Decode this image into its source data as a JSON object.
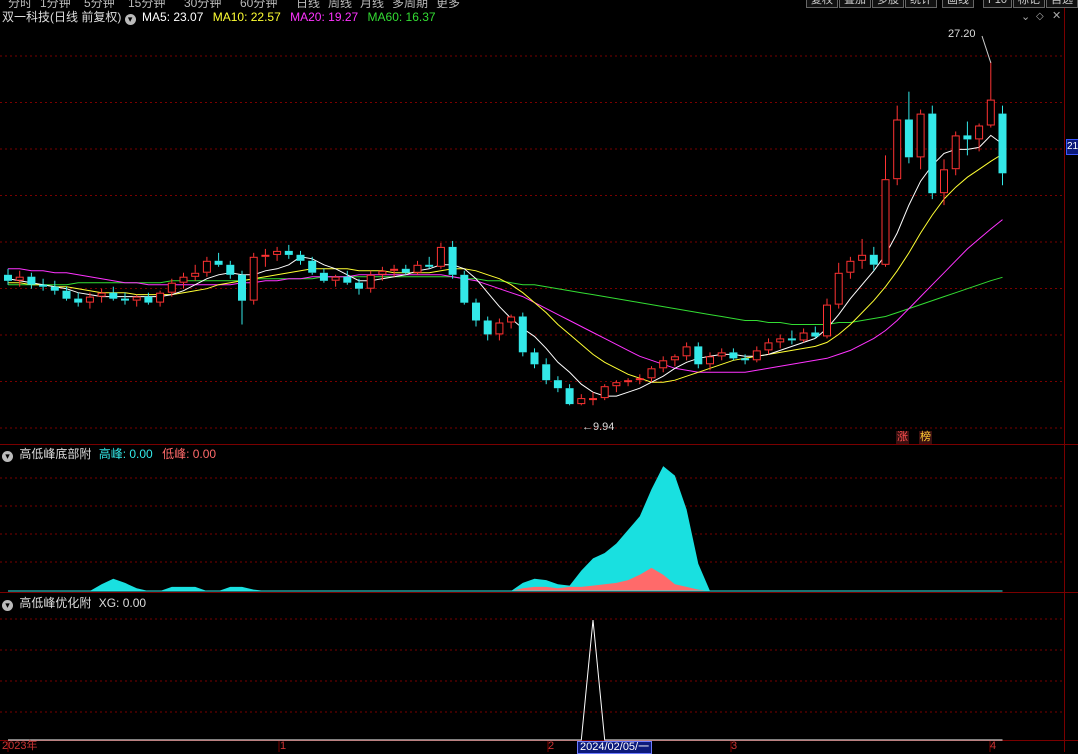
{
  "toolbar": {
    "timeframes": [
      "分时",
      "1分钟",
      "5分钟",
      "15分钟",
      "30分钟",
      "60分钟",
      "日线",
      "周线",
      "月线",
      "多周期",
      "更多"
    ],
    "buttons": [
      "复权",
      "叠加",
      "多股",
      "统计",
      "画线",
      "F10",
      "标记",
      "自选"
    ]
  },
  "main_panel": {
    "title": "双一科技(日线 前复权)",
    "ma_labels": [
      {
        "text": "MA5: 23.07",
        "color": "#ffffff"
      },
      {
        "text": "MA10: 22.57",
        "color": "#ffff33"
      },
      {
        "text": "MA20: 19.27",
        "color": "#ff33ff"
      },
      {
        "text": "MA60: 16.37",
        "color": "#33dd33"
      }
    ],
    "high_label": "27.20",
    "low_label": "9.94",
    "price_box": "21",
    "badges": [
      "涨",
      "榜"
    ]
  },
  "sub_panel1": {
    "title": "高低峰底部附",
    "high_label": "高峰: 0.00",
    "low_label": "低峰: 0.00"
  },
  "sub_panel2": {
    "title": "高低峰优化附",
    "xg_label": "XG: 0.00"
  },
  "x_axis": {
    "labels": [
      "2023年",
      "1",
      "2",
      "3",
      "4"
    ],
    "cursor_date": "2024/02/05/一"
  },
  "colors": {
    "up": "#ff3333",
    "down": "#33e8e8",
    "grid": "#7a0000",
    "ma5": "#ffffff",
    "ma10": "#ffff33",
    "ma20": "#ff33ff",
    "ma60": "#33dd33",
    "high_fill": "#19e0e0",
    "low_fill": "#ff6a6a",
    "xg_line": "#ffffff"
  },
  "chart_data": {
    "type": "candlestick",
    "candles": [
      [
        16.5,
        16.8,
        16.0,
        16.2
      ],
      [
        16.2,
        16.7,
        15.9,
        16.4
      ],
      [
        16.4,
        16.6,
        15.8,
        16.0
      ],
      [
        16.0,
        16.3,
        15.7,
        15.9
      ],
      [
        15.9,
        16.2,
        15.5,
        15.7
      ],
      [
        15.7,
        15.9,
        15.2,
        15.3
      ],
      [
        15.3,
        15.6,
        14.9,
        15.1
      ],
      [
        15.1,
        15.6,
        14.8,
        15.4
      ],
      [
        15.4,
        15.8,
        15.1,
        15.6
      ],
      [
        15.6,
        15.9,
        15.2,
        15.3
      ],
      [
        15.3,
        15.6,
        15.0,
        15.2
      ],
      [
        15.2,
        15.5,
        14.9,
        15.4
      ],
      [
        15.4,
        15.6,
        15.0,
        15.1
      ],
      [
        15.1,
        15.7,
        14.9,
        15.6
      ],
      [
        15.6,
        16.3,
        15.4,
        16.1
      ],
      [
        16.1,
        16.6,
        15.8,
        16.4
      ],
      [
        16.4,
        17.0,
        16.2,
        16.6
      ],
      [
        16.6,
        17.4,
        16.4,
        17.2
      ],
      [
        17.2,
        17.6,
        16.9,
        17.0
      ],
      [
        17.0,
        17.2,
        16.3,
        16.5
      ],
      [
        16.5,
        16.7,
        14.0,
        15.2
      ],
      [
        15.2,
        17.6,
        15.0,
        17.4
      ],
      [
        17.4,
        17.8,
        16.9,
        17.5
      ],
      [
        17.5,
        17.9,
        17.2,
        17.7
      ],
      [
        17.7,
        18.0,
        17.3,
        17.5
      ],
      [
        17.5,
        17.7,
        17.0,
        17.2
      ],
      [
        17.2,
        17.4,
        16.5,
        16.6
      ],
      [
        16.6,
        16.8,
        16.1,
        16.2
      ],
      [
        16.2,
        16.5,
        15.9,
        16.4
      ],
      [
        16.4,
        16.7,
        16.0,
        16.1
      ],
      [
        16.1,
        16.3,
        15.5,
        15.8
      ],
      [
        15.8,
        16.7,
        15.6,
        16.5
      ],
      [
        16.5,
        16.9,
        16.2,
        16.7
      ],
      [
        16.7,
        17.0,
        16.4,
        16.8
      ],
      [
        16.8,
        17.0,
        16.5,
        16.6
      ],
      [
        16.6,
        17.2,
        16.5,
        17.0
      ],
      [
        17.0,
        17.4,
        16.8,
        16.9
      ],
      [
        16.9,
        18.1,
        16.8,
        17.9
      ],
      [
        17.9,
        18.2,
        16.3,
        16.5
      ],
      [
        16.5,
        16.7,
        15.0,
        15.1
      ],
      [
        15.1,
        15.3,
        13.9,
        14.2
      ],
      [
        14.2,
        14.4,
        13.2,
        13.5
      ],
      [
        13.5,
        14.3,
        13.2,
        14.1
      ],
      [
        14.1,
        14.5,
        13.8,
        14.4
      ],
      [
        14.4,
        14.6,
        12.4,
        12.6
      ],
      [
        12.6,
        12.8,
        11.8,
        12.0
      ],
      [
        12.0,
        12.3,
        11.0,
        11.2
      ],
      [
        11.2,
        11.4,
        10.6,
        10.8
      ],
      [
        10.8,
        11.0,
        9.94,
        10.0
      ],
      [
        10.0,
        10.5,
        9.94,
        10.3
      ],
      [
        10.3,
        10.6,
        9.94,
        10.3
      ],
      [
        10.3,
        11.0,
        10.2,
        10.9
      ],
      [
        10.9,
        11.2,
        10.6,
        11.1
      ],
      [
        11.1,
        11.3,
        10.9,
        11.2
      ],
      [
        11.2,
        11.5,
        11.0,
        11.3
      ],
      [
        11.3,
        11.9,
        11.1,
        11.8
      ],
      [
        11.8,
        12.4,
        11.6,
        12.2
      ],
      [
        12.2,
        12.5,
        11.9,
        12.4
      ],
      [
        12.4,
        13.1,
        12.2,
        12.9
      ],
      [
        12.9,
        13.1,
        11.8,
        12.0
      ],
      [
        12.0,
        12.6,
        11.7,
        12.4
      ],
      [
        12.4,
        12.8,
        12.2,
        12.6
      ],
      [
        12.6,
        12.8,
        12.2,
        12.3
      ],
      [
        12.3,
        12.5,
        12.0,
        12.2
      ],
      [
        12.2,
        12.9,
        12.1,
        12.7
      ],
      [
        12.7,
        13.3,
        12.5,
        13.1
      ],
      [
        13.1,
        13.5,
        12.8,
        13.3
      ],
      [
        13.3,
        13.7,
        13.0,
        13.2
      ],
      [
        13.2,
        13.8,
        13.1,
        13.6
      ],
      [
        13.6,
        13.9,
        13.3,
        13.4
      ],
      [
        13.4,
        15.3,
        13.3,
        15.0
      ],
      [
        15.0,
        17.1,
        14.8,
        16.6
      ],
      [
        16.6,
        17.4,
        16.3,
        17.2
      ],
      [
        17.2,
        18.3,
        16.8,
        17.5
      ],
      [
        17.5,
        17.9,
        16.7,
        17.0
      ],
      [
        17.0,
        22.5,
        16.9,
        21.3
      ],
      [
        21.3,
        25.0,
        21.0,
        24.3
      ],
      [
        24.3,
        25.7,
        22.1,
        22.4
      ],
      [
        22.4,
        24.8,
        21.8,
        24.6
      ],
      [
        24.6,
        25.0,
        20.3,
        20.6
      ],
      [
        20.6,
        22.3,
        20.0,
        21.8
      ],
      [
        21.8,
        23.7,
        21.5,
        23.5
      ],
      [
        23.5,
        24.2,
        22.5,
        23.3
      ],
      [
        23.3,
        24.1,
        22.7,
        24.0
      ],
      [
        24.0,
        27.2,
        23.9,
        25.3
      ],
      [
        24.6,
        25.0,
        21.0,
        21.6
      ]
    ],
    "ma5": [
      16.3,
      16.2,
      16.1,
      16.0,
      15.9,
      15.8,
      15.6,
      15.5,
      15.4,
      15.4,
      15.4,
      15.4,
      15.4,
      15.4,
      15.5,
      15.7,
      16.0,
      16.3,
      16.5,
      16.6,
      16.5,
      16.5,
      16.7,
      16.8,
      17.0,
      17.4,
      17.3,
      17.0,
      16.8,
      16.5,
      16.2,
      16.2,
      16.3,
      16.4,
      16.5,
      16.7,
      16.8,
      17.0,
      17.0,
      16.8,
      16.3,
      15.6,
      14.9,
      14.3,
      13.8,
      13.4,
      12.8,
      12.1,
      11.6,
      11.0,
      10.6,
      10.4,
      10.4,
      10.6,
      10.8,
      11.1,
      11.4,
      11.8,
      12.1,
      12.3,
      12.4,
      12.5,
      12.5,
      12.4,
      12.4,
      12.5,
      12.7,
      12.9,
      13.1,
      13.3,
      13.8,
      14.5,
      15.3,
      16.0,
      16.7,
      17.5,
      18.6,
      20.0,
      21.2,
      22.0,
      22.6,
      22.8,
      22.8,
      22.9,
      23.5,
      23.07
    ],
    "ma10": [
      16.1,
      16.1,
      16.0,
      16.0,
      15.9,
      15.9,
      15.8,
      15.7,
      15.6,
      15.6,
      15.6,
      15.5,
      15.5,
      15.5,
      15.5,
      15.6,
      15.7,
      15.8,
      16.0,
      16.1,
      16.2,
      16.3,
      16.4,
      16.5,
      16.6,
      16.7,
      16.8,
      16.8,
      16.8,
      16.8,
      16.7,
      16.7,
      16.7,
      16.6,
      16.6,
      16.6,
      16.6,
      16.7,
      16.8,
      16.8,
      16.7,
      16.5,
      16.3,
      16.0,
      15.6,
      15.1,
      14.6,
      14.0,
      13.5,
      13.0,
      12.5,
      12.1,
      11.8,
      11.5,
      11.3,
      11.1,
      11.1,
      11.2,
      11.4,
      11.6,
      11.8,
      12.0,
      12.2,
      12.3,
      12.4,
      12.5,
      12.6,
      12.7,
      12.8,
      12.9,
      13.1,
      13.5,
      14.0,
      14.6,
      15.2,
      15.9,
      16.7,
      17.6,
      18.6,
      19.5,
      20.3,
      20.9,
      21.4,
      21.8,
      22.2,
      22.57
    ],
    "ma20": [
      16.8,
      16.8,
      16.7,
      16.7,
      16.6,
      16.6,
      16.5,
      16.4,
      16.3,
      16.2,
      16.1,
      16.1,
      16.0,
      16.0,
      16.0,
      16.0,
      16.0,
      16.0,
      16.0,
      16.0,
      16.1,
      16.1,
      16.2,
      16.2,
      16.3,
      16.3,
      16.4,
      16.4,
      16.4,
      16.4,
      16.5,
      16.5,
      16.5,
      16.5,
      16.5,
      16.5,
      16.5,
      16.5,
      16.4,
      16.3,
      16.2,
      16.0,
      15.8,
      15.6,
      15.4,
      15.1,
      14.8,
      14.5,
      14.2,
      13.9,
      13.6,
      13.3,
      13.0,
      12.7,
      12.4,
      12.2,
      12.0,
      11.8,
      11.7,
      11.6,
      11.6,
      11.6,
      11.6,
      11.6,
      11.7,
      11.8,
      11.9,
      12.0,
      12.1,
      12.2,
      12.3,
      12.5,
      12.7,
      13.0,
      13.3,
      13.7,
      14.2,
      14.8,
      15.4,
      16.0,
      16.6,
      17.2,
      17.8,
      18.3,
      18.8,
      19.27
    ],
    "ma60": [
      16.0,
      16.0,
      16.0,
      16.0,
      16.0,
      16.0,
      16.1,
      16.1,
      16.1,
      16.1,
      16.1,
      16.1,
      16.1,
      16.1,
      16.2,
      16.2,
      16.2,
      16.2,
      16.2,
      16.2,
      16.2,
      16.3,
      16.3,
      16.3,
      16.3,
      16.3,
      16.3,
      16.4,
      16.4,
      16.4,
      16.4,
      16.4,
      16.4,
      16.4,
      16.4,
      16.4,
      16.4,
      16.4,
      16.4,
      16.3,
      16.3,
      16.2,
      16.2,
      16.1,
      16.0,
      16.0,
      15.9,
      15.8,
      15.7,
      15.6,
      15.5,
      15.4,
      15.3,
      15.2,
      15.1,
      15.0,
      14.9,
      14.8,
      14.7,
      14.6,
      14.5,
      14.4,
      14.3,
      14.2,
      14.2,
      14.1,
      14.1,
      14.0,
      14.0,
      14.0,
      14.0,
      14.1,
      14.1,
      14.2,
      14.3,
      14.4,
      14.6,
      14.8,
      15.0,
      15.2,
      15.4,
      15.6,
      15.8,
      16.0,
      16.2,
      16.37
    ],
    "ylim": [
      9.0,
      29.0
    ],
    "high_peak": [
      0,
      0,
      0,
      0,
      0,
      0,
      0,
      0,
      0.5,
      0.9,
      0.6,
      0.2,
      0,
      0,
      0.3,
      0.3,
      0.3,
      0,
      0,
      0.3,
      0.3,
      0.1,
      0,
      0,
      0,
      0,
      0,
      0,
      0,
      0,
      0,
      0,
      0,
      0,
      0,
      0,
      0,
      0,
      0,
      0,
      0,
      0,
      0,
      0,
      0.6,
      0.9,
      0.8,
      0.5,
      0.4,
      1.5,
      2.4,
      2.8,
      3.5,
      4.5,
      5.5,
      7.5,
      9.2,
      8.5,
      6.0,
      2.0,
      0,
      0,
      0,
      0,
      0,
      0,
      0,
      0,
      0,
      0,
      0,
      0,
      0,
      0,
      0,
      0,
      0,
      0,
      0,
      0,
      0,
      0,
      0,
      0,
      0,
      0
    ],
    "low_peak": [
      0,
      0,
      0,
      0,
      0,
      0,
      0,
      0,
      0,
      0,
      0,
      0,
      0,
      0,
      0,
      0,
      0,
      0,
      0,
      0,
      0,
      0,
      0,
      0,
      0,
      0,
      0,
      0,
      0,
      0,
      0,
      0,
      0,
      0,
      0,
      0,
      0,
      0,
      0,
      0,
      0,
      0,
      0,
      0,
      0.2,
      0.3,
      0.3,
      0.2,
      0.3,
      0.3,
      0.4,
      0.5,
      0.6,
      0.8,
      1.2,
      1.7,
      1.2,
      0.5,
      0.3,
      0.1,
      0,
      0,
      0,
      0,
      0,
      0,
      0,
      0,
      0,
      0,
      0,
      0,
      0,
      0,
      0,
      0,
      0,
      0,
      0,
      0,
      0,
      0,
      0,
      0,
      0,
      0
    ],
    "sub1_ylim": [
      0,
      9.5
    ],
    "xg": [
      0,
      0,
      0,
      0,
      0,
      0,
      0,
      0,
      0,
      0,
      0,
      0,
      0,
      0,
      0,
      0,
      0,
      0,
      0,
      0,
      0,
      0,
      0,
      0,
      0,
      0,
      0,
      0,
      0,
      0,
      0,
      0,
      0,
      0,
      0,
      0,
      0,
      0,
      0,
      0,
      0,
      0,
      0,
      0,
      0,
      0,
      0,
      0,
      0,
      0,
      1,
      0,
      0,
      0,
      0,
      0,
      0,
      0,
      0,
      0,
      0,
      0,
      0,
      0,
      0,
      0,
      0,
      0,
      0,
      0,
      0,
      0,
      0,
      0,
      0,
      0,
      0,
      0,
      0,
      0,
      0,
      0,
      0,
      0,
      0,
      0
    ],
    "xg_ylim": [
      0,
      1.05
    ]
  }
}
